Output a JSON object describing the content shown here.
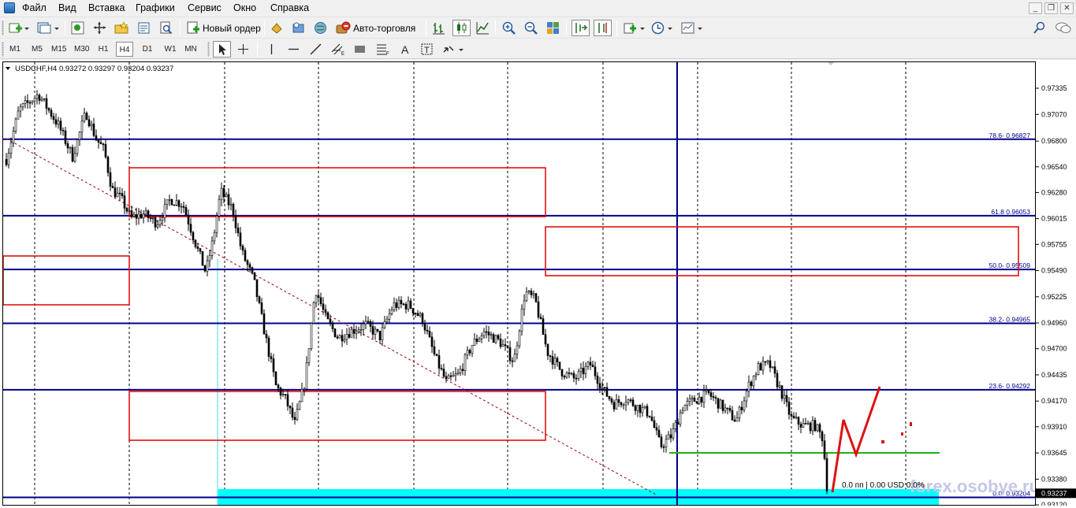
{
  "menu": [
    "Файл",
    "Вид",
    "Вставка",
    "Графики",
    "Сервис",
    "Окно",
    "Справка"
  ],
  "window_controls": [
    "_",
    "❐",
    "✕"
  ],
  "toolbar": {
    "new_order_label": "Новый ордер",
    "autotrading_label": "Авто-торговля"
  },
  "timeframes": [
    "M1",
    "M5",
    "M15",
    "M30",
    "H1",
    "H4",
    "D1",
    "W1",
    "MN"
  ],
  "active_timeframe": "H4",
  "chart": {
    "symbol_header": "USDCHF,H4  0.93272 0.93297 0.93204 0.93237",
    "price_levels": [
      "0.97335",
      "0.97070",
      "0.96800",
      "0.96540",
      "0.96280",
      "0.96015",
      "0.95755",
      "0.95490",
      "0.95225",
      "0.94960",
      "0.94700",
      "0.94435",
      "0.94170",
      "0.93910",
      "0.93645",
      "0.93380",
      "0.93120"
    ],
    "current_price": "0.93237",
    "fib_levels": [
      {
        "label": "78.6- 0.96827",
        "price": 0.96827
      },
      {
        "label": "61.8 0.96053",
        "price": 0.96053
      },
      {
        "label": "50.0- 0.95509",
        "price": 0.95509
      },
      {
        "label": "38.2- 0.94965",
        "price": 0.94965
      },
      {
        "label": "23.6- 0.94292",
        "price": 0.94292
      },
      {
        "label": "0.0- 0.93204",
        "price": 0.93204
      }
    ],
    "trade_info": "0.0 пп | 0.00 USD  0.0%",
    "watermark": "forex.osobye.ru",
    "colors": {
      "fib_line": "#00008b",
      "zone_border": "#e00000",
      "support_line": "#22b014",
      "highlight_band": "#00ffff",
      "trendline": "#a00000",
      "forecast": "#e01010",
      "candle": "#000000"
    }
  }
}
